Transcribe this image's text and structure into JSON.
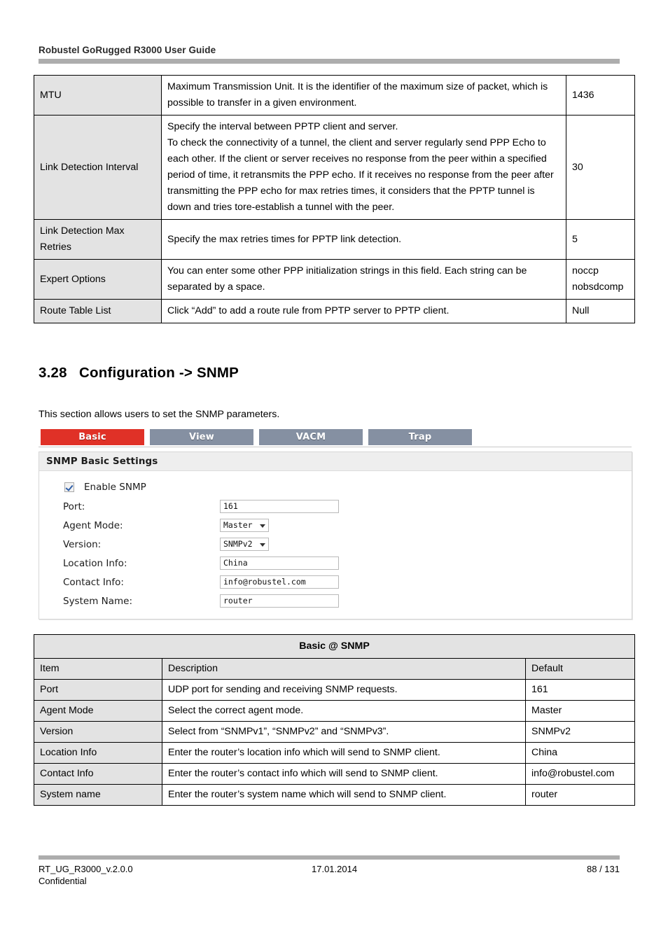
{
  "header": {
    "title": "Robustel GoRugged R3000 User Guide"
  },
  "pptp_table": {
    "rows": [
      {
        "item": "MTU",
        "description": "Maximum Transmission Unit. It is the identifier of the maximum size of packet, which is possible to transfer in a given environment.",
        "default": "1436"
      },
      {
        "item": "Link Detection Interval",
        "description": "Specify the interval between PPTP client and server.\nTo check the connectivity of a tunnel, the client and server regularly send PPP Echo to each other. If the client or server receives no response from the peer within a specified period of time, it retransmits the PPP echo. If it receives no response from the peer after transmitting the PPP echo for max retries times, it considers that the PPTP tunnel is down and tries tore-establish a tunnel with the peer.",
        "default": "30"
      },
      {
        "item": "Link    Detection    Max Retries",
        "description": "Specify the max retries times for PPTP link detection.",
        "default": "5"
      },
      {
        "item": "Expert Options",
        "description": "You can enter some other PPP initialization strings in this field. Each string can be separated by a space.",
        "default": "noccp nobsdcomp"
      },
      {
        "item": "Route Table List",
        "description": "Click “Add” to add a route rule from PPTP server to PPTP client.",
        "default": "Null"
      }
    ]
  },
  "section": {
    "number": "3.28",
    "title": "Configuration -> SNMP",
    "intro": "This section allows users to set the SNMP parameters."
  },
  "router_ui": {
    "tabs": [
      {
        "label": "Basic",
        "active": true
      },
      {
        "label": "View",
        "active": false
      },
      {
        "label": "VACM",
        "active": false
      },
      {
        "label": "Trap",
        "active": false
      }
    ],
    "panel_title": "SNMP Basic Settings",
    "enable_checkbox": {
      "label": "Enable SNMP",
      "checked": true
    },
    "fields": [
      {
        "label": "Port:",
        "value": "161",
        "type": "input"
      },
      {
        "label": "Agent Mode:",
        "value": "Master",
        "type": "select"
      },
      {
        "label": "Version:",
        "value": "SNMPv2",
        "type": "select"
      },
      {
        "label": "Location Info:",
        "value": "China",
        "type": "input"
      },
      {
        "label": "Contact Info:",
        "value": "info@robustel.com",
        "type": "input"
      },
      {
        "label": "System Name:",
        "value": "router",
        "type": "input"
      }
    ],
    "colors": {
      "active_tab": "#e03127",
      "inactive_tab": "#8590a2",
      "panel_title_bg": "#eeeeee"
    }
  },
  "snmp_table": {
    "title": "Basic @ SNMP",
    "columns": [
      "Item",
      "Description",
      "Default"
    ],
    "rows": [
      {
        "item": "Port",
        "description": "UDP port for sending and receiving SNMP requests.",
        "default": "161"
      },
      {
        "item": "Agent Mode",
        "description": "Select the correct agent mode.",
        "default": "Master"
      },
      {
        "item": "Version",
        "description": "Select from “SNMPv1”, “SNMPv2” and “SNMPv3”.",
        "default": "SNMPv2"
      },
      {
        "item": "Location Info",
        "description": "Enter the router’s location info which will send to SNMP client.",
        "default": "China"
      },
      {
        "item": "Contact Info",
        "description": "Enter the router’s contact info which will send to SNMP client.",
        "default": "info@robustel.com"
      },
      {
        "item": "System name",
        "description": "Enter the router’s system name which will send to SNMP client.",
        "default": "router"
      }
    ]
  },
  "footer": {
    "doc_id": "RT_UG_R3000_v.2.0.0",
    "date": "17.01.2014",
    "page": "88 / 131",
    "confidential": "Confidential"
  }
}
